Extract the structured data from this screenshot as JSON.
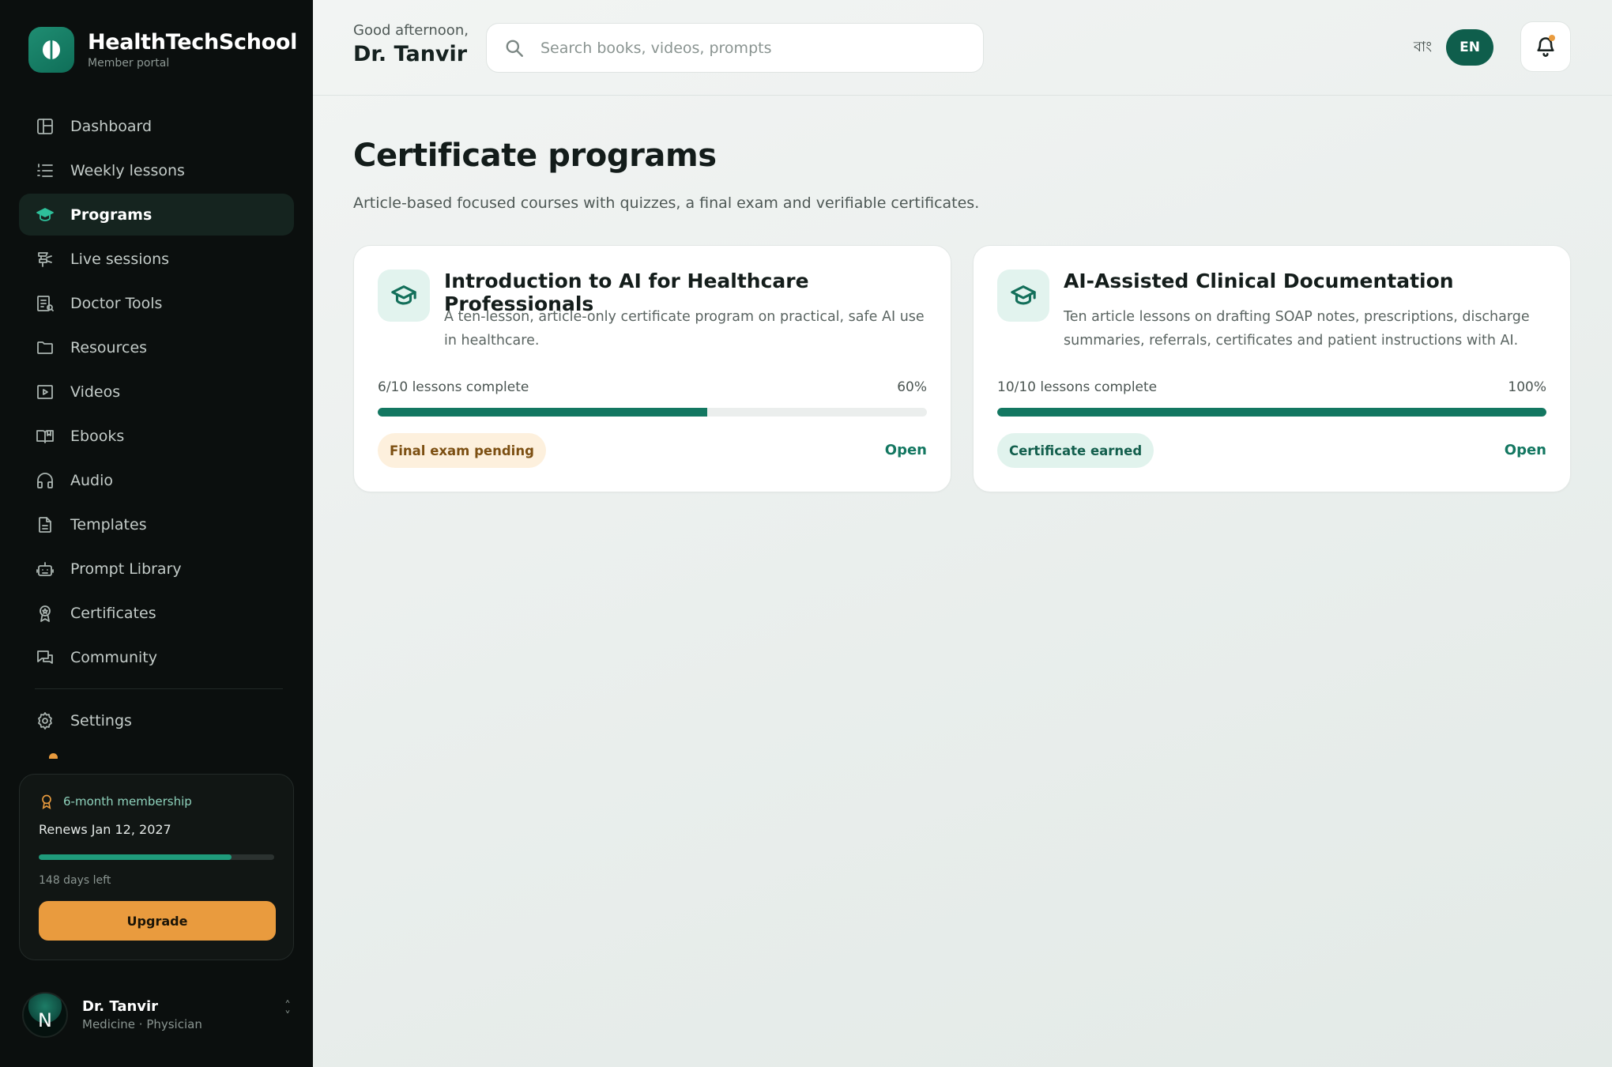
{
  "brand": {
    "name": "HealthTechSchool",
    "subtitle": "Member portal"
  },
  "sidebar": {
    "items": [
      {
        "label": "Dashboard",
        "icon": "layout-icon",
        "active": false
      },
      {
        "label": "Weekly lessons",
        "icon": "list-icon",
        "active": false
      },
      {
        "label": "Programs",
        "icon": "graduation-cap-icon",
        "active": true
      },
      {
        "label": "Live sessions",
        "icon": "broadcast-icon",
        "active": false
      },
      {
        "label": "Doctor Tools",
        "icon": "clipboard-icon",
        "active": false
      },
      {
        "label": "Resources",
        "icon": "folder-icon",
        "active": false
      },
      {
        "label": "Videos",
        "icon": "video-icon",
        "active": false
      },
      {
        "label": "Ebooks",
        "icon": "book-icon",
        "active": false
      },
      {
        "label": "Audio",
        "icon": "headphones-icon",
        "active": false
      },
      {
        "label": "Templates",
        "icon": "file-icon",
        "active": false
      },
      {
        "label": "Prompt Library",
        "icon": "robot-icon",
        "active": false
      },
      {
        "label": "Certificates",
        "icon": "award-icon",
        "active": false
      },
      {
        "label": "Community",
        "icon": "chat-icon",
        "active": false
      }
    ],
    "settings_label": "Settings"
  },
  "membership": {
    "plan": "6-month membership",
    "renews": "Renews Jan 12, 2027",
    "progress": 0.82,
    "days_left": "148 days left",
    "upgrade_label": "Upgrade"
  },
  "user": {
    "initial": "N",
    "name": "Dr. Tanvir",
    "role": "Medicine · Physician"
  },
  "header": {
    "greeting": "Good afternoon,",
    "name": "Dr. Tanvir",
    "search_placeholder": "Search books, videos, prompts",
    "lang_bn": "বাং",
    "lang_en": "EN"
  },
  "page": {
    "title": "Certificate programs",
    "subtitle": "Article-based focused courses with quizzes, a final exam and verifiable certificates."
  },
  "programs": [
    {
      "title": "Introduction to AI for Healthcare Professionals",
      "description": "A ten-lesson, article-only certificate program on practical, safe AI use in healthcare.",
      "progress_label": "6/10 lessons complete",
      "progress_pct": "60%",
      "progress": 0.6,
      "badge": "Final exam pending",
      "badge_status": "pending",
      "open_label": "Open"
    },
    {
      "title": "AI-Assisted Clinical Documentation",
      "description": "Ten article lessons on drafting SOAP notes, prescriptions, discharge summaries, referrals, certificates and patient instructions with AI.",
      "progress_label": "10/10 lessons complete",
      "progress_pct": "100%",
      "progress": 1.0,
      "badge": "Certificate earned",
      "badge_status": "earned",
      "open_label": "Open"
    }
  ],
  "colors": {
    "accent": "#137761",
    "sidebar_bg": "#0b0f0e",
    "warning": "#e99b3e",
    "active_icon": "#2ec09a"
  }
}
